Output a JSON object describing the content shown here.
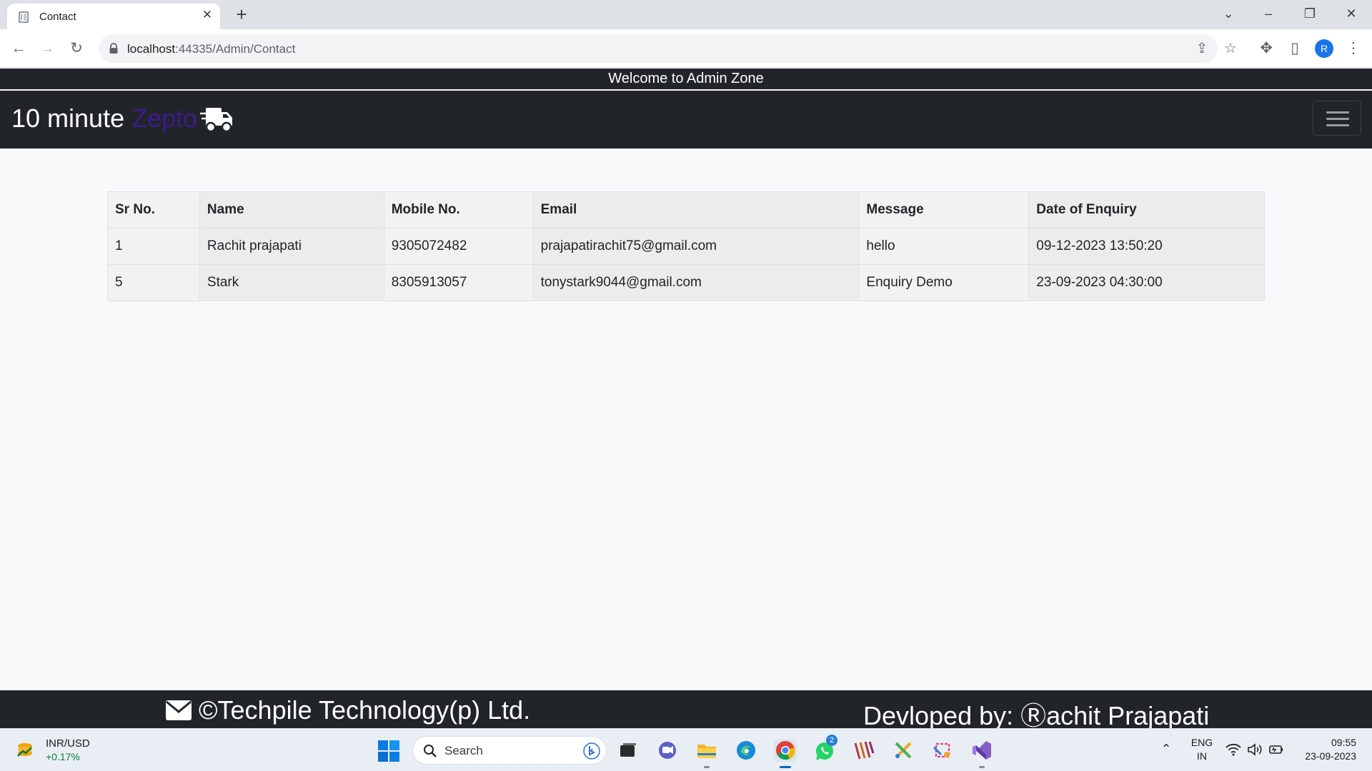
{
  "browser": {
    "tab_title": "Contact",
    "url_host": "localhost",
    "url_rest": ":44335/Admin/Contact",
    "profile_initial": "R"
  },
  "page": {
    "welcome_text": "Welcome to Admin Zone",
    "brand_prefix": "10 minute",
    "brand_accent": "Zepto",
    "brand_accent_color": "#3d1a8c",
    "table": {
      "headers": [
        "Sr No.",
        "Name",
        "Mobile No.",
        "Email",
        "Message",
        "Date of Enquiry"
      ],
      "rows": [
        [
          "1",
          "Rachit prajapati",
          "9305072482",
          "prajapatirachit75@gmail.com",
          "hello",
          "09-12-2023 13:50:20"
        ],
        [
          "5",
          "Stark",
          "8305913057",
          "tonystark9044@gmail.com",
          "Enquiry Demo",
          "23-09-2023 04:30:00"
        ]
      ]
    },
    "footer_left": "©Techpile Technology(p) Ltd.",
    "footer_right": "Devloped by: Ⓡachit Prajapati"
  },
  "taskbar": {
    "ticker_name": "INR/USD",
    "ticker_change": "+0.17%",
    "search_label": "Search",
    "whatsapp_badge": "2",
    "lang_line1": "ENG",
    "lang_line2": "IN",
    "time": "09:55",
    "date": "23-09-2023"
  }
}
